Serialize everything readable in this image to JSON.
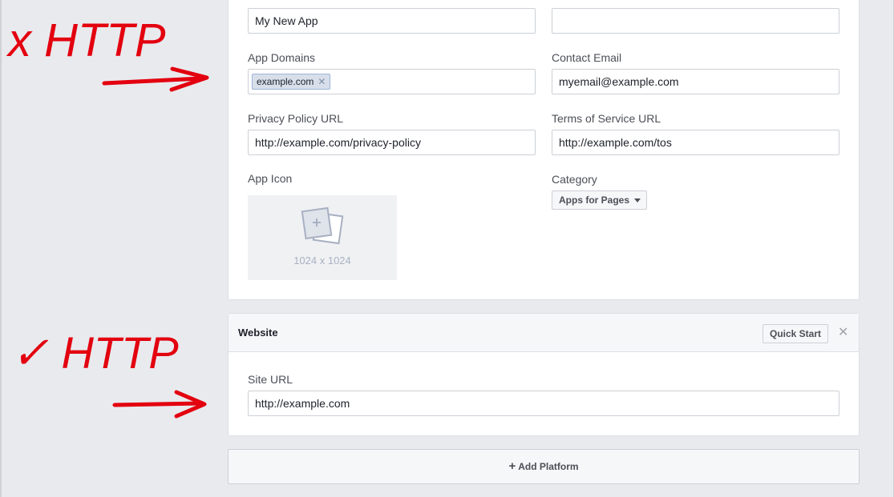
{
  "basic": {
    "display_name_value": "My New App",
    "namespace_value": "",
    "app_domains_label": "App Domains",
    "app_domain_tag": "example.com",
    "contact_email_label": "Contact Email",
    "contact_email_value": "myemail@example.com",
    "privacy_label": "Privacy Policy URL",
    "privacy_value": "http://example.com/privacy-policy",
    "tos_label": "Terms of Service URL",
    "tos_value": "http://example.com/tos",
    "app_icon_label": "App Icon",
    "app_icon_size": "1024 x 1024",
    "category_label": "Category",
    "category_value": "Apps for Pages"
  },
  "website": {
    "title": "Website",
    "quick_start": "Quick Start",
    "site_url_label": "Site URL",
    "site_url_value": "http://example.com"
  },
  "add_platform": "Add Platform",
  "annotations": {
    "bad_mark": "x HTTP",
    "good_mark": "✓ HTTP",
    "color": "#e3000f"
  }
}
